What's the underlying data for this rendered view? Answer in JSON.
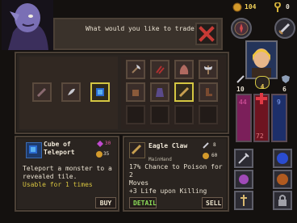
{
  "dialog": {
    "prompt": "What would you like to trade?"
  },
  "hud": {
    "gold": "104",
    "keys": "0",
    "level": "4",
    "left_stat": "10",
    "right_stat": "6",
    "health_value": "44",
    "mana_value": "9",
    "mid_value": "72"
  },
  "left_item": {
    "name_line1": "Cube of",
    "name_line2": "Teleport",
    "cost": "30",
    "cost2": "35",
    "desc_line1": "Teleport a monster to a",
    "desc_line2": "revealed tile.",
    "usage": "Usable for 1 times",
    "buy_label": "BUY"
  },
  "right_item": {
    "name": "Eagle Claw",
    "cost": "8",
    "cost2": "60",
    "slot": "MainHand",
    "stat_line1": "17%   Chance to Poison for",
    "stat_line2": "2",
    "stat_line3": "Moves",
    "stat_line4": "+3 Life upon Killing",
    "detail_label": "DETAIL",
    "sell_label": "SELL"
  },
  "colors": {
    "health": "#c0254e",
    "mana": "#2a4fb0",
    "highlight": "#d4c642"
  }
}
